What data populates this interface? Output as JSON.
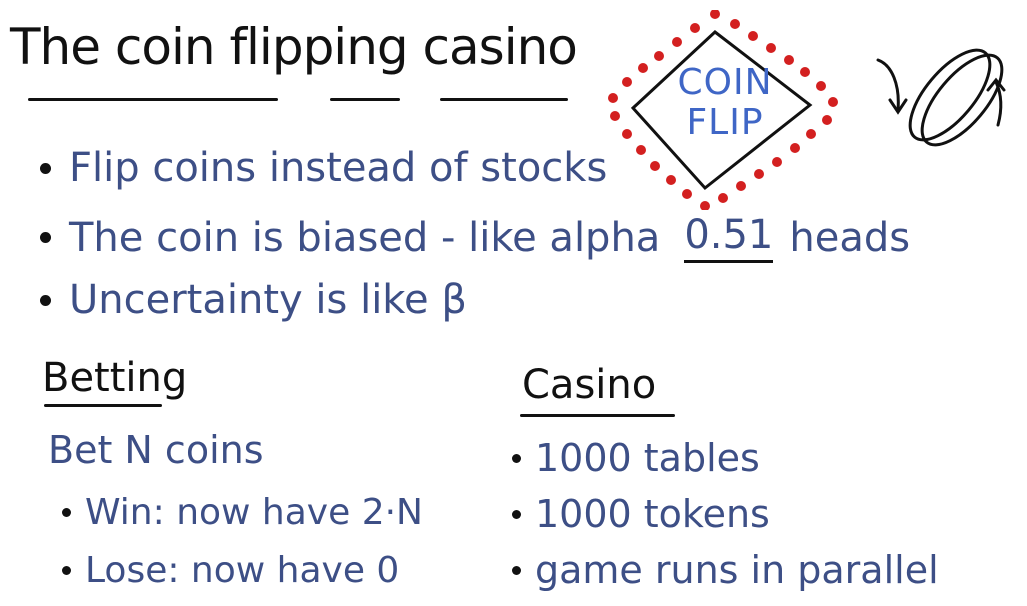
{
  "title": "The coin flipping casino",
  "emblem": {
    "line1": "COIN",
    "line2": "FLIP"
  },
  "bullets": [
    "Flip coins instead of stocks",
    "The coin is biased - like alpha",
    "Uncertainty is like β"
  ],
  "bias_value": "0.51",
  "bias_suffix": "heads",
  "betting": {
    "heading": "Betting",
    "intro": "Bet N coins",
    "items": [
      "Win: now have 2·N",
      "Lose: now have 0"
    ]
  },
  "casino": {
    "heading": "Casino",
    "items": [
      "1000 tables",
      "1000 tokens",
      "game runs in parallel"
    ]
  },
  "colors": {
    "ink_black": "#111111",
    "ink_blue": "#3d4f86",
    "emblem_red": "#d32020",
    "emblem_blue": "#3f66c6"
  },
  "icons": [
    "coin-flip-emblem",
    "spinning-coin-icon"
  ]
}
